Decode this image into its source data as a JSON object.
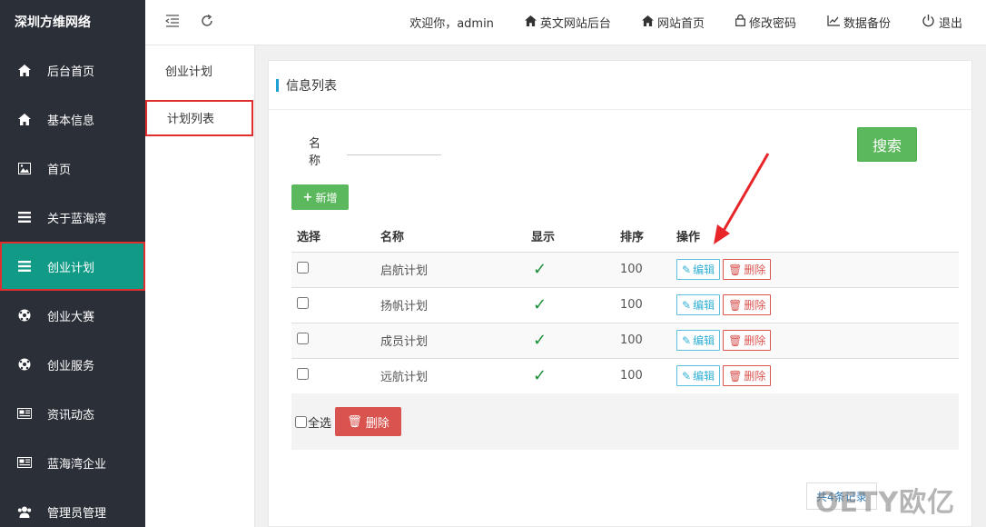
{
  "brand": "深圳方维网络",
  "sidebar": {
    "items": [
      {
        "label": "后台首页",
        "icon": "home-icon"
      },
      {
        "label": "基本信息",
        "icon": "home-icon"
      },
      {
        "label": "首页",
        "icon": "image-icon"
      },
      {
        "label": "关于蓝海湾",
        "icon": "list-icon"
      },
      {
        "label": "创业计划",
        "icon": "list-icon",
        "active": true
      },
      {
        "label": "创业大赛",
        "icon": "soccer-ball-icon"
      },
      {
        "label": "创业服务",
        "icon": "soccer-ball-icon"
      },
      {
        "label": "资讯动态",
        "icon": "newspaper-icon"
      },
      {
        "label": "蓝海湾企业",
        "icon": "newspaper-icon"
      },
      {
        "label": "管理员管理",
        "icon": "users-icon"
      }
    ]
  },
  "topbar": {
    "welcome": "欢迎你，admin",
    "links": [
      {
        "label": "英文网站后台",
        "icon": "home-icon"
      },
      {
        "label": "网站首页",
        "icon": "home-icon"
      },
      {
        "label": "修改密码",
        "icon": "lock-icon"
      },
      {
        "label": "数据备份",
        "icon": "chart-icon"
      },
      {
        "label": "退出",
        "icon": "power-icon"
      }
    ]
  },
  "submenu": {
    "title": "创业计划",
    "active_item": "计划列表"
  },
  "panel": {
    "title": "信息列表",
    "search_label_1": "名",
    "search_label_2": "称",
    "search_value": "",
    "search_button": "搜索",
    "add_button": "新增",
    "columns": [
      "选择",
      "名称",
      "显示",
      "排序",
      "操作"
    ],
    "rows": [
      {
        "name": "启航计划",
        "show": "✓",
        "order": "100"
      },
      {
        "name": "扬帆计划",
        "show": "✓",
        "order": "100"
      },
      {
        "name": "成员计划",
        "show": "✓",
        "order": "100"
      },
      {
        "name": "远航计划",
        "show": "✓",
        "order": "100"
      }
    ],
    "edit_label": "编辑",
    "delete_label": "删除",
    "select_all_label": "全选",
    "bulk_delete_label": "删除",
    "pager_text": "共4条记录"
  },
  "watermark": "OETY欧亿",
  "colors": {
    "sidebar_bg": "#2b2f38",
    "active_bg": "#119b86",
    "highlight": "#e02d2d",
    "success": "#5cb85c",
    "danger": "#d9534f",
    "info": "#5bc0de"
  }
}
